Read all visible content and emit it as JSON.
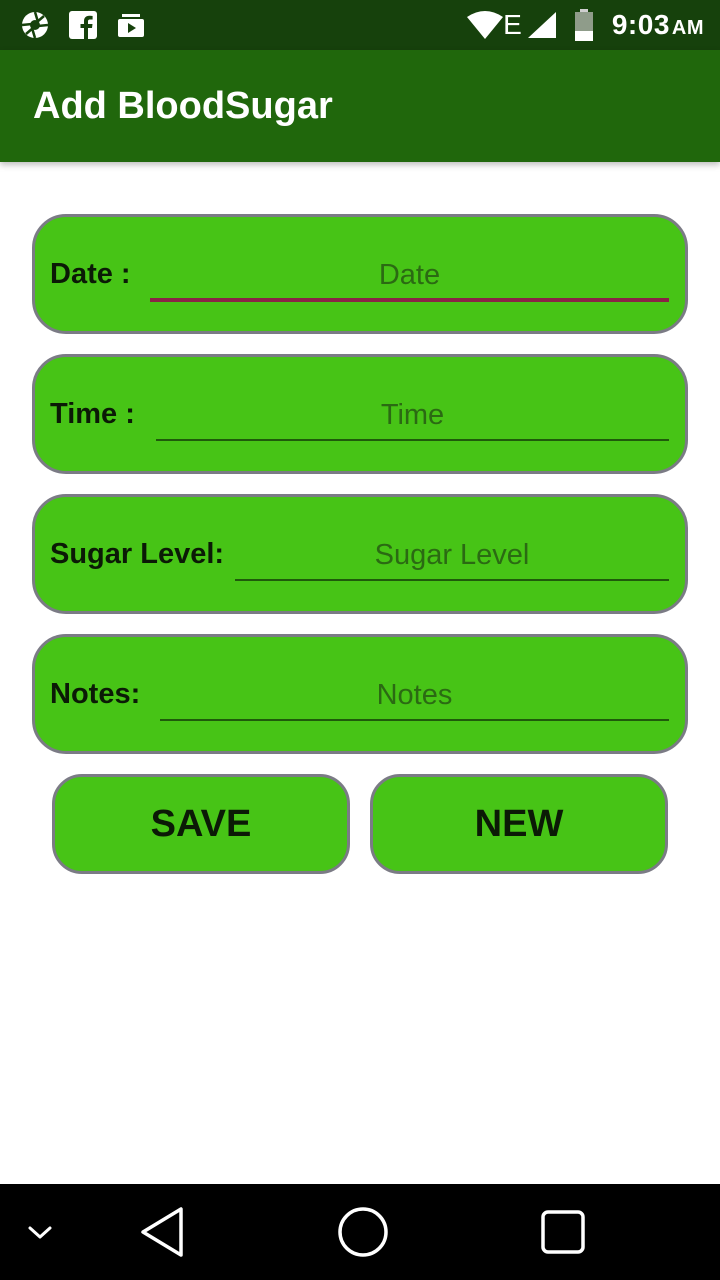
{
  "status_bar": {
    "network_type": "E",
    "time": "9:03",
    "ampm": "AM",
    "icons": [
      "aperture-icon",
      "facebook-icon",
      "media-icon",
      "wifi-icon",
      "signal-icon",
      "battery-icon"
    ]
  },
  "app_bar": {
    "title": "Add BloodSugar"
  },
  "form": {
    "date": {
      "label": "Date :",
      "placeholder": "Date",
      "value": ""
    },
    "time": {
      "label": "Time :",
      "placeholder": "Time",
      "value": ""
    },
    "sugar_level": {
      "label": "Sugar Level:",
      "placeholder": "Sugar Level",
      "value": ""
    },
    "notes": {
      "label": "Notes:",
      "placeholder": "Notes",
      "value": ""
    }
  },
  "buttons": {
    "save_label": "SAVE",
    "new_label": "NEW"
  },
  "nav_bar": {
    "icons": [
      "collapse-icon",
      "back-icon",
      "home-icon",
      "recents-icon"
    ]
  },
  "colors": {
    "status_bar": "#16410c",
    "app_bar": "#20670c",
    "card_fill": "#47c416",
    "card_border": "#7b7b85",
    "focus_underline": "#8a2346"
  }
}
